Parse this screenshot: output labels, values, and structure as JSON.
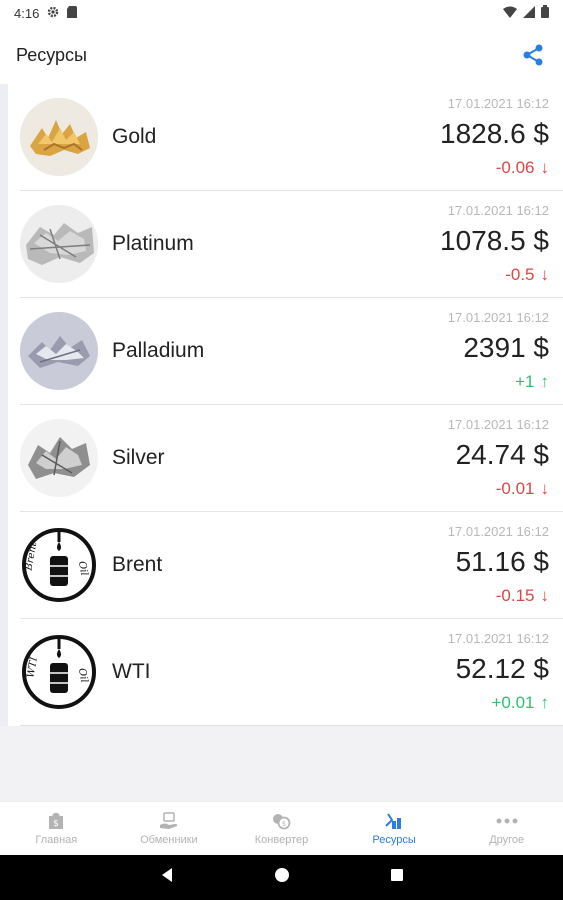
{
  "status": {
    "time": "4:16"
  },
  "appbar": {
    "title": "Ресурсы"
  },
  "items": [
    {
      "name": "Gold",
      "date": "17.01.2021 16:12",
      "price": "1828.6 $",
      "change": "-0.06",
      "dir": "down",
      "arrow": "↓"
    },
    {
      "name": "Platinum",
      "date": "17.01.2021 16:12",
      "price": "1078.5 $",
      "change": "-0.5",
      "dir": "down",
      "arrow": "↓"
    },
    {
      "name": "Palladium",
      "date": "17.01.2021 16:12",
      "price": "2391 $",
      "change": "+1",
      "dir": "up",
      "arrow": "↑"
    },
    {
      "name": "Silver",
      "date": "17.01.2021 16:12",
      "price": "24.74 $",
      "change": "-0.01",
      "dir": "down",
      "arrow": "↓"
    },
    {
      "name": "Brent",
      "date": "17.01.2021 16:12",
      "price": "51.16 $",
      "change": "-0.15",
      "dir": "down",
      "arrow": "↓",
      "logo_text": "Brent Oil"
    },
    {
      "name": "WTI",
      "date": "17.01.2021 16:12",
      "price": "52.12 $",
      "change": "+0.01",
      "dir": "up",
      "arrow": "↑",
      "logo_text": "WTI Oil"
    }
  ],
  "nav": [
    {
      "label": "Главная",
      "icon": "home-bag-icon",
      "active": false
    },
    {
      "label": "Обменники",
      "icon": "exchange-hand-icon",
      "active": false
    },
    {
      "label": "Конвертер",
      "icon": "converter-icon",
      "active": false
    },
    {
      "label": "Ресурсы",
      "icon": "resources-icon",
      "active": true
    },
    {
      "label": "Другое",
      "icon": "more-dots-icon",
      "active": false
    }
  ],
  "colors": {
    "accent": "#2a7de1",
    "down": "#d94848",
    "up": "#2fbf71"
  }
}
